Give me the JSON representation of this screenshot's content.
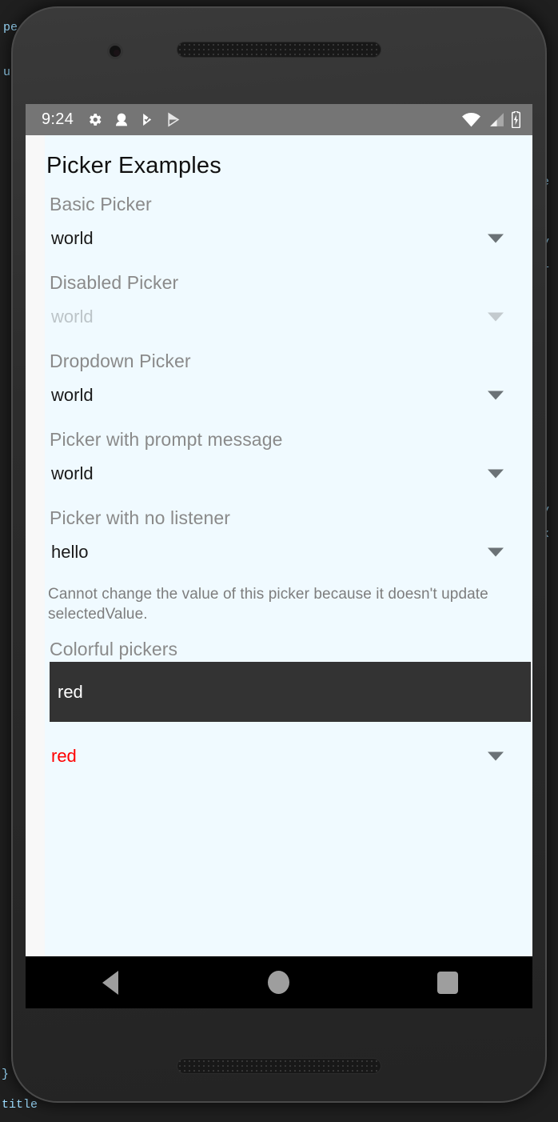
{
  "backdrop": {
    "lines": [
      "pe",
      "u",
      "",
      "",
      "e",
      "",
      "y",
      "i",
      "",
      "",
      "",
      "",
      "",
      "",
      "",
      "",
      "",
      "",
      "y",
      "k",
      "",
      "",
      "",
      "",
      "",
      "",
      "",
      "",
      "",
      "",
      "",
      "}",
      "title"
    ]
  },
  "statusbar": {
    "time": "9:24",
    "left_icons": [
      "gear-icon",
      "chat-bubble-icon",
      "check-flag-icon",
      "play-store-icon"
    ],
    "right_icons": [
      "wifi-icon",
      "cellular-signal-icon",
      "battery-charging-icon"
    ]
  },
  "app": {
    "title": "Picker Examples"
  },
  "sections": [
    {
      "label": "Basic Picker",
      "value": "world",
      "state": "enabled",
      "arrow": "dropdown-arrow-icon"
    },
    {
      "label": "Disabled Picker",
      "value": "world",
      "state": "disabled",
      "arrow": "dropdown-arrow-icon"
    },
    {
      "label": "Dropdown Picker",
      "value": "world",
      "state": "enabled",
      "arrow": "dropdown-arrow-icon"
    },
    {
      "label": "Picker with prompt message",
      "value": "world",
      "state": "enabled",
      "arrow": "dropdown-arrow-icon"
    },
    {
      "label": "Picker with no listener",
      "value": "hello",
      "state": "enabled",
      "arrow": "dropdown-arrow-icon",
      "note": "Cannot change the value of this picker because it doesn't update selectedValue."
    }
  ],
  "colorful": {
    "label": "Colorful pickers",
    "dark_picker": {
      "value": "red",
      "background": "#333333",
      "text_color": "#ffffff"
    },
    "red_picker": {
      "value": "red",
      "text_color": "#ff0000",
      "arrow": "dropdown-arrow-icon"
    }
  },
  "navbar": {
    "back": "back-triangle-icon",
    "home": "home-circle-icon",
    "recents": "recents-square-icon"
  },
  "colors": {
    "status_bar": "#757575",
    "content_bg": "#f0faff",
    "screen_bg": "#f8f8f8",
    "label_gray": "#8a8a8a",
    "accent_red": "#ff0000",
    "dark_picker": "#333333"
  }
}
